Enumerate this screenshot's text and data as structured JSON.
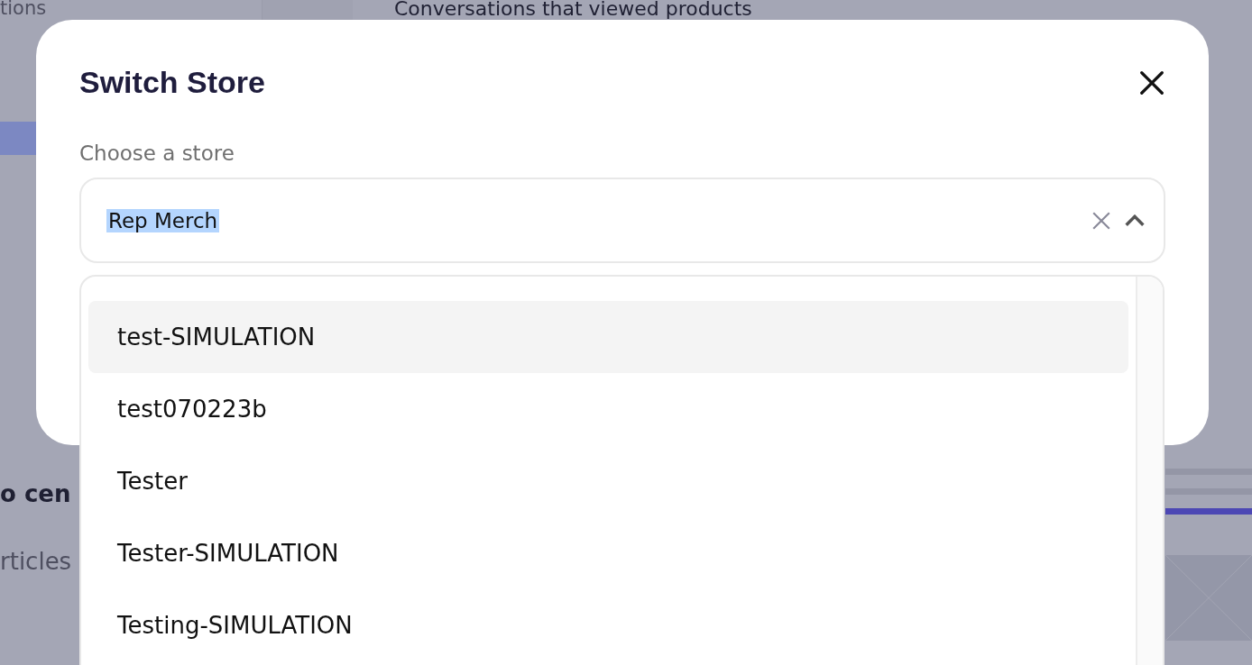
{
  "background": {
    "texts": [
      {
        "kind": "nav",
        "text": "tions"
      },
      {
        "kind": "heading",
        "text": "Conversations that viewed products"
      },
      {
        "kind": "bold",
        "text": "o cen"
      },
      {
        "kind": "muted",
        "text": "rticles"
      }
    ]
  },
  "dialog": {
    "title": "Switch Store",
    "field_label": "Choose a store",
    "value": "Rep Merch",
    "value_highlighted": true,
    "expanded": true,
    "options": [
      {
        "label": "test-SIMULATION",
        "selected": true
      },
      {
        "label": "test070223b",
        "selected": false
      },
      {
        "label": "Tester",
        "selected": false
      },
      {
        "label": "Tester-SIMULATION",
        "selected": false
      },
      {
        "label": "Testing-SIMULATION",
        "selected": false
      }
    ]
  }
}
